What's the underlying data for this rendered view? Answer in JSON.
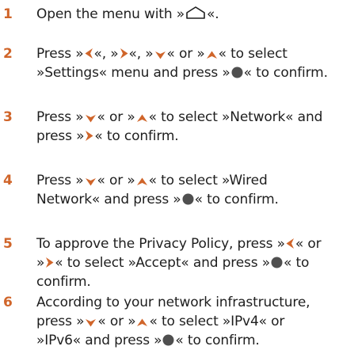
{
  "colors": {
    "step_number": "#d0652a",
    "body_text": "#1e1e1e",
    "key_icon": "#d0652a",
    "ok_icon": "#4f4f4f",
    "home_icon_stroke": "#1e1e1e"
  },
  "icons": {
    "home": "home-outline",
    "left": "arrow-left",
    "right": "arrow-right",
    "down": "arrow-down",
    "up": "arrow-up",
    "ok": "ok-dot"
  },
  "steps": [
    {
      "number": "1",
      "lines": [
        [
          {
            "t": "Open the menu with »"
          },
          {
            "i": "home"
          },
          {
            "t": "«."
          }
        ]
      ]
    },
    {
      "number": "2",
      "lines": [
        [
          {
            "t": "Press »"
          },
          {
            "i": "left"
          },
          {
            "t": "«, »"
          },
          {
            "i": "right"
          },
          {
            "t": "«, »"
          },
          {
            "i": "down"
          },
          {
            "t": "« or »"
          },
          {
            "i": "up"
          },
          {
            "t": "« to select"
          }
        ],
        [
          {
            "t": "»Settings« menu and press »"
          },
          {
            "i": "ok"
          },
          {
            "t": "« to confirm."
          }
        ]
      ]
    },
    {
      "number": "3",
      "lines": [
        [
          {
            "t": "Press »"
          },
          {
            "i": "down"
          },
          {
            "t": "« or »"
          },
          {
            "i": "up"
          },
          {
            "t": "« to select »Network« and"
          }
        ],
        [
          {
            "t": "press »"
          },
          {
            "i": "right"
          },
          {
            "t": "« to confirm."
          }
        ]
      ]
    },
    {
      "number": "4",
      "lines": [
        [
          {
            "t": "Press »"
          },
          {
            "i": "down"
          },
          {
            "t": "« or »"
          },
          {
            "i": "up"
          },
          {
            "t": "« to select »Wired"
          }
        ],
        [
          {
            "t": "Network« and press »"
          },
          {
            "i": "ok"
          },
          {
            "t": "« to confirm."
          }
        ]
      ]
    },
    {
      "number": "5",
      "lines": [
        [
          {
            "t": "To approve the Privacy Policy, press »"
          },
          {
            "i": "left"
          },
          {
            "t": "« or"
          }
        ],
        [
          {
            "t": "»"
          },
          {
            "i": "right"
          },
          {
            "t": "« to select »Accept« and press »"
          },
          {
            "i": "ok"
          },
          {
            "t": "« to"
          }
        ],
        [
          {
            "t": "confirm."
          }
        ]
      ]
    },
    {
      "number": "6",
      "lines": [
        [
          {
            "t": "According to your network infrastructure,"
          }
        ],
        [
          {
            "t": "press »"
          },
          {
            "i": "down"
          },
          {
            "t": "« or »"
          },
          {
            "i": "up"
          },
          {
            "t": "« to select »IPv4« or"
          }
        ],
        [
          {
            "t": "»IPv6« and press »"
          },
          {
            "i": "ok"
          },
          {
            "t": "« to confirm."
          }
        ]
      ]
    }
  ]
}
